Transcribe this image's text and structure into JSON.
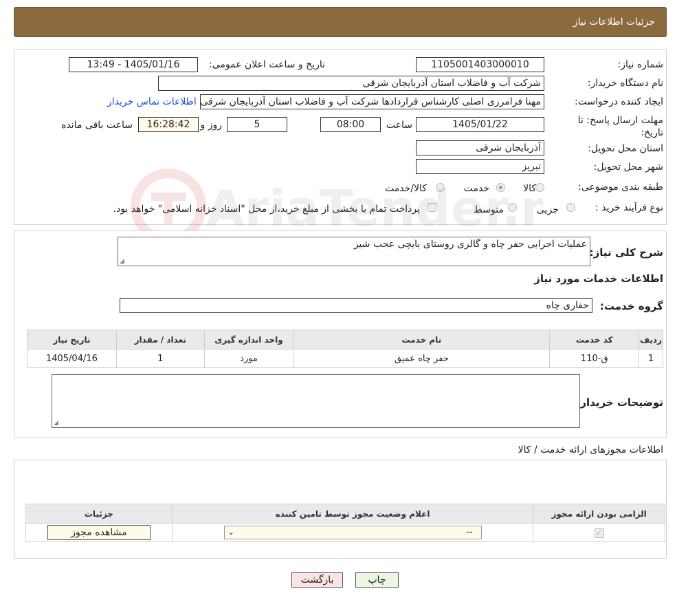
{
  "header": {
    "title": "جزئیات اطلاعات نیاز"
  },
  "labels": {
    "need_number": "شماره نیاز:",
    "announce_datetime": "تاریخ و ساعت اعلان عمومی:",
    "buyer_org": "نام دستگاه خریدار:",
    "requester": "ایجاد کننده درخواست:",
    "reply_deadline": "مهلت ارسال پاسخ: تا تاریخ:",
    "hour": "ساعت",
    "day_and": "روز و",
    "remaining": "ساعت باقی مانده",
    "delivery_province": "استان محل تحویل:",
    "delivery_city": "شهر محل تحویل:",
    "category": "طبقه بندی موضوعی:",
    "process_type": "نوع فرآیند خرید :",
    "general_desc": "شرح کلی نیاز:",
    "services_info": "اطلاعات خدمات مورد نیاز",
    "service_group": "گروه خدمت:",
    "buyer_notes": "توضیحات خریدار:",
    "permits_info": "اطلاعات مجوزهای ارائه خدمت / کالا"
  },
  "values": {
    "need_number": "1105001403000010",
    "announce_datetime": "1405/01/16 - 13:49",
    "buyer_org": "شرکت آب و فاضلاب استان آذربایجان شرقی",
    "requester": "مهنا فرامرزی اصلی کارشناس قراردادها شرکت آب و فاضلاب استان آذربایجان شرقی",
    "contact_link": "اطلاعات تماس خریدار",
    "deadline_date": "1405/01/22",
    "deadline_time": "08:00",
    "days": "5",
    "remaining_time": "16:28:42",
    "delivery_province": "آذربایجان شرقی",
    "delivery_city": "تبریز",
    "general_desc": "عملیات اجرایی حفر چاه و گالری روستای یایچی عجب شیر",
    "service_group": "حفاری چاه",
    "buyer_notes": ""
  },
  "category_options": [
    "کالا",
    "خدمت",
    "کالا/خدمت"
  ],
  "category_selected": "خدمت",
  "process_options": [
    "جزیی",
    "متوسط"
  ],
  "process_note": "پرداخت تمام یا بخشی از مبلغ خرید،از محل \"اسناد خزانه اسلامی\" خواهد بود.",
  "services_table": {
    "headers": [
      "ردیف",
      "کد خدمت",
      "نام خدمت",
      "واحد اندازه گیری",
      "تعداد / مقدار",
      "تاریخ نیاز"
    ],
    "rows": [
      [
        "1",
        "ق-110",
        "حفر چاه عمیق",
        "مورد",
        "1",
        "1405/04/16"
      ]
    ]
  },
  "permits_table": {
    "headers": [
      "الزامی بودن ارائه مجوز",
      "اعلام وضعیت مجوز توسط تامین کننده",
      "جزئیات"
    ],
    "select_value": "--",
    "view_button": "مشاهده مجوز"
  },
  "buttons": {
    "print": "چاپ",
    "back": "بازگشت"
  },
  "watermark": "AriaTender.neT",
  "colors": {
    "header_bg": "#8b6a3e",
    "link": "#1a4fd8",
    "back_bg": "#fde4e4",
    "print_bg": "#eaf7e4",
    "view_bg": "#fffbe8"
  }
}
